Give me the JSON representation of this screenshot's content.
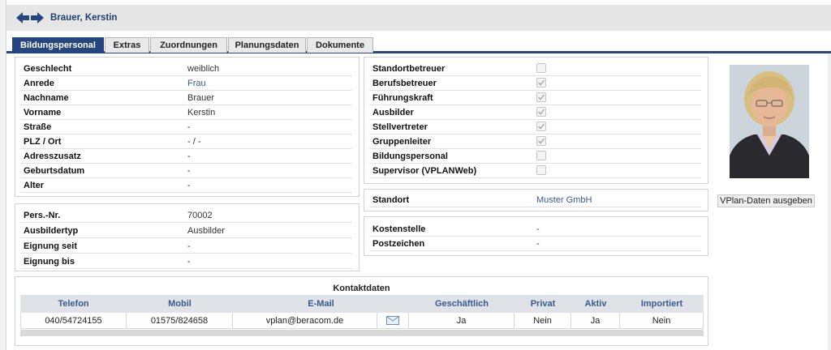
{
  "header": {
    "title": "Brauer, Kerstin"
  },
  "tabs": [
    {
      "label": "Bildungspersonal",
      "active": true
    },
    {
      "label": "Extras"
    },
    {
      "label": "Zuordnungen"
    },
    {
      "label": "Planungsdaten"
    },
    {
      "label": "Dokumente"
    }
  ],
  "personal": [
    {
      "label": "Geschlecht",
      "value": "weiblich"
    },
    {
      "label": "Anrede",
      "value": "Frau"
    },
    {
      "label": "Nachname",
      "value": "Brauer"
    },
    {
      "label": "Vorname",
      "value": "Kerstin"
    },
    {
      "label": "Straße",
      "value": "-"
    },
    {
      "label": "PLZ / Ort",
      "value": "- / -"
    },
    {
      "label": "Adresszusatz",
      "value": "-"
    },
    {
      "label": "Geburtsdatum",
      "value": "-"
    },
    {
      "label": "Alter",
      "value": "-"
    }
  ],
  "employment": [
    {
      "label": "Pers.-Nr.",
      "value": "70002"
    },
    {
      "label": "Ausbildertyp",
      "value": "Ausbilder"
    },
    {
      "label": "Eignung seit",
      "value": "-"
    },
    {
      "label": "Eignung bis",
      "value": "-"
    }
  ],
  "roles": [
    {
      "label": "Standortbetreuer",
      "checked": false
    },
    {
      "label": "Berufsbetreuer",
      "checked": true
    },
    {
      "label": "Führungskraft",
      "checked": true
    },
    {
      "label": "Ausbilder",
      "checked": true
    },
    {
      "label": "Stellvertreter",
      "checked": true
    },
    {
      "label": "Gruppenleiter",
      "checked": true
    },
    {
      "label": "Bildungspersonal",
      "checked": false
    },
    {
      "label": "Supervisor (VPLANWeb)",
      "checked": false
    }
  ],
  "standort": {
    "label": "Standort",
    "value": "Muster GmbH"
  },
  "cost": [
    {
      "label": "Kostenstelle",
      "value": "-"
    },
    {
      "label": "Postzeichen",
      "value": "-"
    }
  ],
  "vplan_button": "VPlan-Daten ausgeben",
  "kontakt": {
    "title": "Kontaktdaten",
    "headers": [
      "Telefon",
      "Mobil",
      "E-Mail",
      "Geschäftlich",
      "Privat",
      "Aktiv",
      "Importiert"
    ],
    "row": {
      "telefon": "040/54724155",
      "mobil": "01575/824658",
      "email": "vplan@beracom.de",
      "geschaeftlich": "Ja",
      "privat": "Nein",
      "aktiv": "Ja",
      "importiert": "Nein"
    }
  },
  "icons": {
    "back": "arrow-left-icon",
    "forward": "arrow-right-icon",
    "mail": "envelope-icon",
    "check": "checkmark-icon"
  },
  "colors": {
    "accent": "#25467e",
    "link": "#3a5a8e",
    "header_bg": "#e6e6e6"
  }
}
